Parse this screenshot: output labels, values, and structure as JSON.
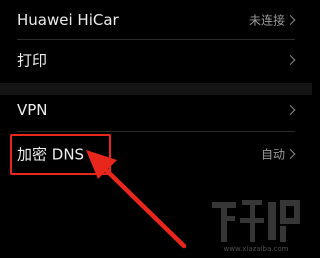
{
  "settings": {
    "rows": [
      {
        "label": "Huawei HiCar",
        "value": "未连接"
      },
      {
        "label": "打印",
        "value": ""
      },
      {
        "label": "VPN",
        "value": ""
      },
      {
        "label": "加密 DNS",
        "value": "自动"
      }
    ]
  },
  "annotation": {
    "box_color": "#e8261c",
    "arrow_color": "#e8261c"
  },
  "watermark": {
    "text": "下载吧",
    "url": "www.xiazaiba.com"
  }
}
